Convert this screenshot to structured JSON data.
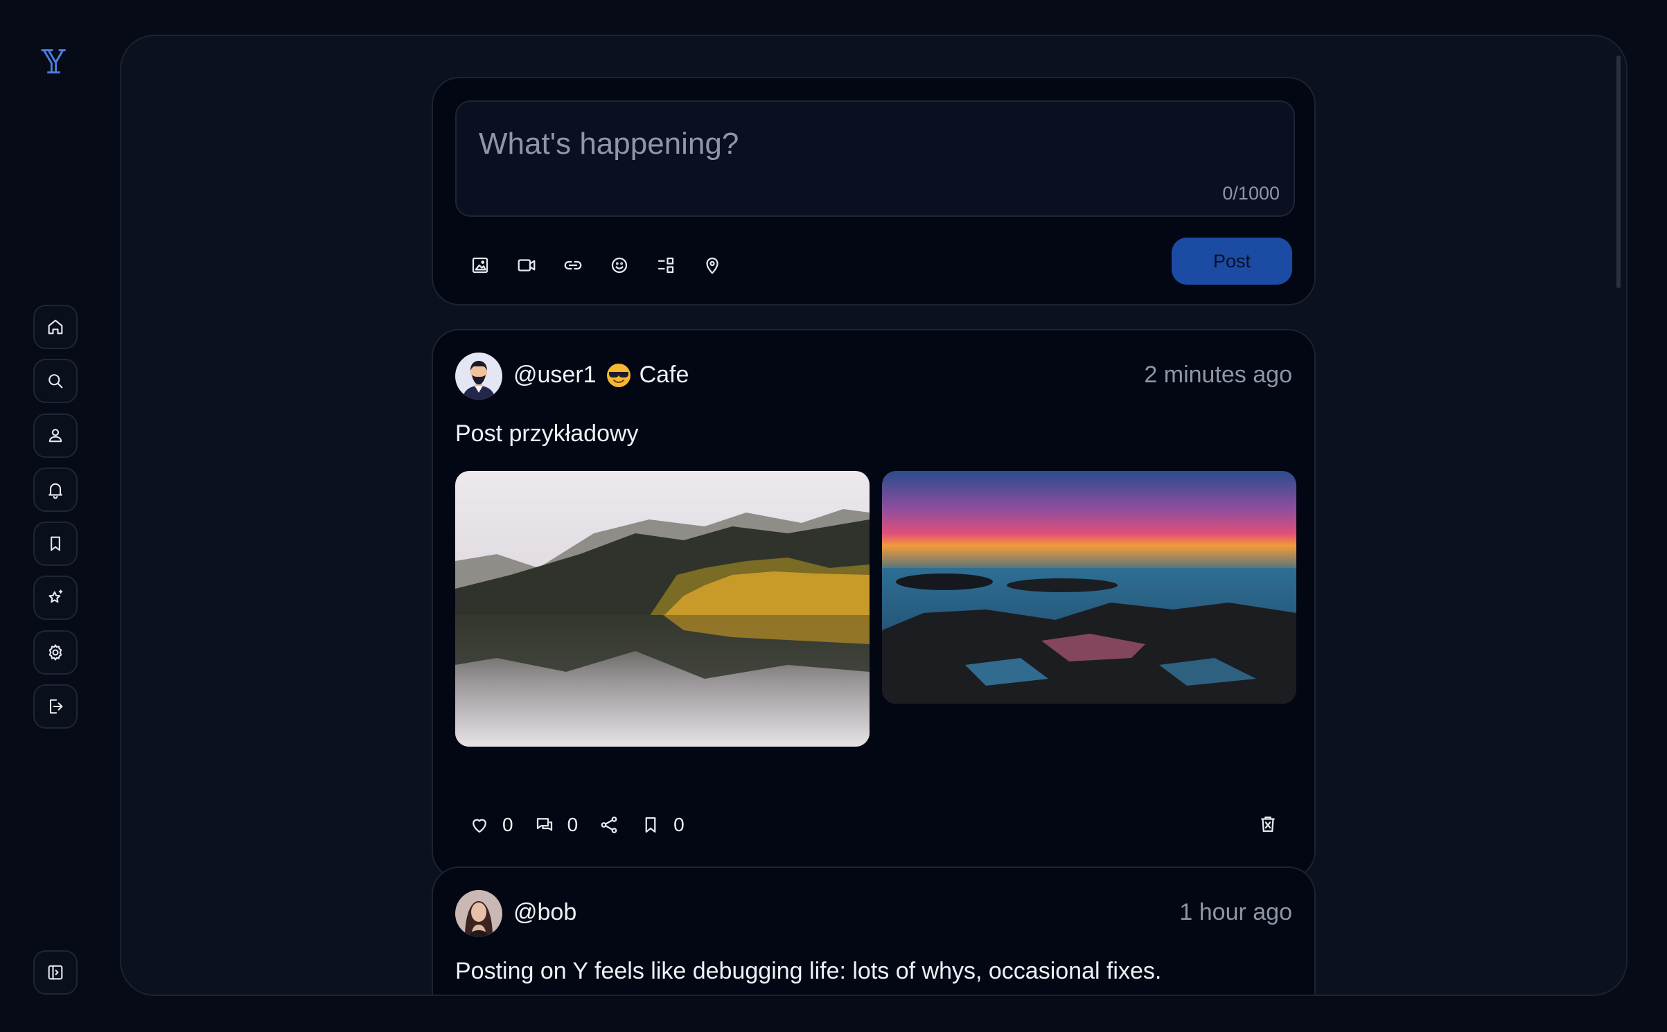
{
  "app": {
    "logo_text": "𝕐"
  },
  "sidebar": {
    "items": [
      {
        "name": "home",
        "icon": "home-icon"
      },
      {
        "name": "search",
        "icon": "search-icon"
      },
      {
        "name": "profile",
        "icon": "user-icon"
      },
      {
        "name": "notifications",
        "icon": "bell-icon"
      },
      {
        "name": "bookmarks",
        "icon": "bookmark-icon"
      },
      {
        "name": "featured",
        "icon": "sparkle-star-icon"
      },
      {
        "name": "settings",
        "icon": "gear-icon"
      },
      {
        "name": "logout",
        "icon": "logout-icon"
      }
    ],
    "collapse_icon": "sidebar-toggle-icon"
  },
  "composer": {
    "placeholder": "What's happening?",
    "counter": "0/1000",
    "tools": [
      "image-icon",
      "video-icon",
      "link-icon",
      "emoji-icon",
      "layout-icon",
      "location-icon"
    ],
    "post_label": "Post",
    "post_button_color": "#1c4ba3"
  },
  "posts": [
    {
      "handle": "@user1",
      "location": "Cafe",
      "time": "2 minutes ago",
      "text": "Post przykładowy",
      "images": [
        "mountain-lake-photo",
        "sunset-coast-photo"
      ],
      "likes": "0",
      "comments": "0",
      "bookmarks": "0"
    },
    {
      "handle": "@bob",
      "time": "1 hour ago",
      "text": "Posting on Y feels like debugging life: lots of whys, occasional fixes."
    }
  ],
  "colors": {
    "background": "#070b17",
    "panel": "#0c1120",
    "card": "#030713",
    "accent": "#1c4ba3",
    "muted_text": "#8e96a8"
  }
}
